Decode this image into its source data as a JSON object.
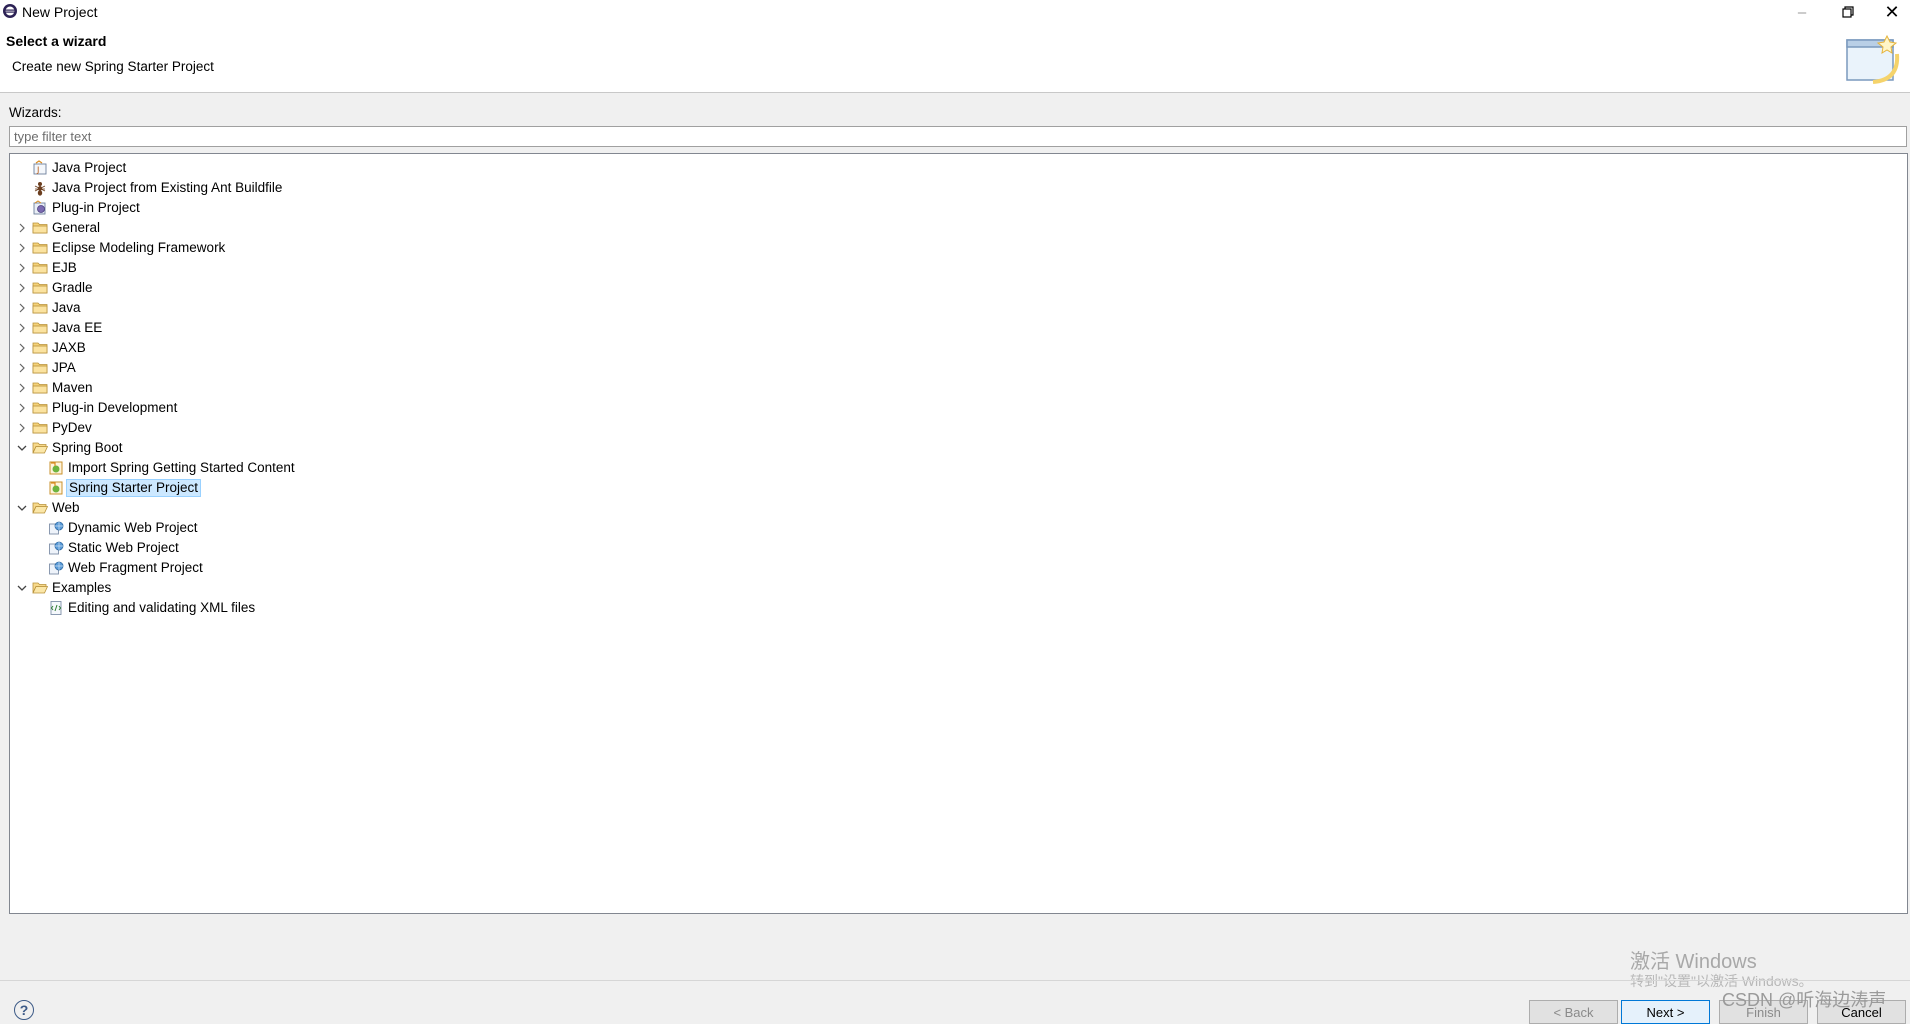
{
  "window": {
    "title": "New Project"
  },
  "header": {
    "title": "Select a wizard",
    "description": "Create new Spring Starter Project"
  },
  "wizards_label": "Wizards:",
  "filter": {
    "placeholder": "type filter text",
    "value": ""
  },
  "tree": [
    {
      "label": "Java Project",
      "icon": "java-project-icon",
      "expanded": null,
      "selected": false
    },
    {
      "label": "Java Project from Existing Ant Buildfile",
      "icon": "ant-buildfile-icon",
      "expanded": null,
      "selected": false
    },
    {
      "label": "Plug-in Project",
      "icon": "plugin-project-icon",
      "expanded": null,
      "selected": false
    },
    {
      "label": "General",
      "icon": "folder-icon",
      "expanded": false,
      "selected": false
    },
    {
      "label": "Eclipse Modeling Framework",
      "icon": "folder-icon",
      "expanded": false,
      "selected": false
    },
    {
      "label": "EJB",
      "icon": "folder-icon",
      "expanded": false,
      "selected": false
    },
    {
      "label": "Gradle",
      "icon": "folder-icon",
      "expanded": false,
      "selected": false
    },
    {
      "label": "Java",
      "icon": "folder-icon",
      "expanded": false,
      "selected": false
    },
    {
      "label": "Java EE",
      "icon": "folder-icon",
      "expanded": false,
      "selected": false
    },
    {
      "label": "JAXB",
      "icon": "folder-icon",
      "expanded": false,
      "selected": false
    },
    {
      "label": "JPA",
      "icon": "folder-icon",
      "expanded": false,
      "selected": false
    },
    {
      "label": "Maven",
      "icon": "folder-icon",
      "expanded": false,
      "selected": false
    },
    {
      "label": "Plug-in Development",
      "icon": "folder-icon",
      "expanded": false,
      "selected": false
    },
    {
      "label": "PyDev",
      "icon": "folder-icon",
      "expanded": false,
      "selected": false
    },
    {
      "label": "Spring Boot",
      "icon": "folder-open-icon",
      "expanded": true,
      "selected": false
    },
    {
      "label": "Import Spring Getting Started Content",
      "icon": "spring-import-icon",
      "expanded": null,
      "selected": false
    },
    {
      "label": "Spring Starter Project",
      "icon": "spring-starter-icon",
      "expanded": null,
      "selected": true
    },
    {
      "label": "Web",
      "icon": "folder-open-icon",
      "expanded": true,
      "selected": false
    },
    {
      "label": "Dynamic Web Project",
      "icon": "dynamic-web-project-icon",
      "expanded": null,
      "selected": false
    },
    {
      "label": "Static Web Project",
      "icon": "static-web-project-icon",
      "expanded": null,
      "selected": false
    },
    {
      "label": "Web Fragment Project",
      "icon": "web-fragment-project-icon",
      "expanded": null,
      "selected": false
    },
    {
      "label": "Examples",
      "icon": "folder-open-icon",
      "expanded": true,
      "selected": false
    },
    {
      "label": "Editing and validating XML files",
      "icon": "xml-example-icon",
      "expanded": null,
      "selected": false
    }
  ],
  "watermark": {
    "line1": "激活 Windows",
    "line2": "转到\"设置\"以激活 Windows。",
    "credit": "CSDN @听海边涛声"
  },
  "buttons": {
    "back": "< Back",
    "next": "Next >",
    "finish": "Finish",
    "cancel": "Cancel",
    "help": "?"
  },
  "colors": {
    "selection_bg": "#cce8ff",
    "default_button_border": "#0078d7",
    "dialog_bg": "#f0f0f0"
  }
}
